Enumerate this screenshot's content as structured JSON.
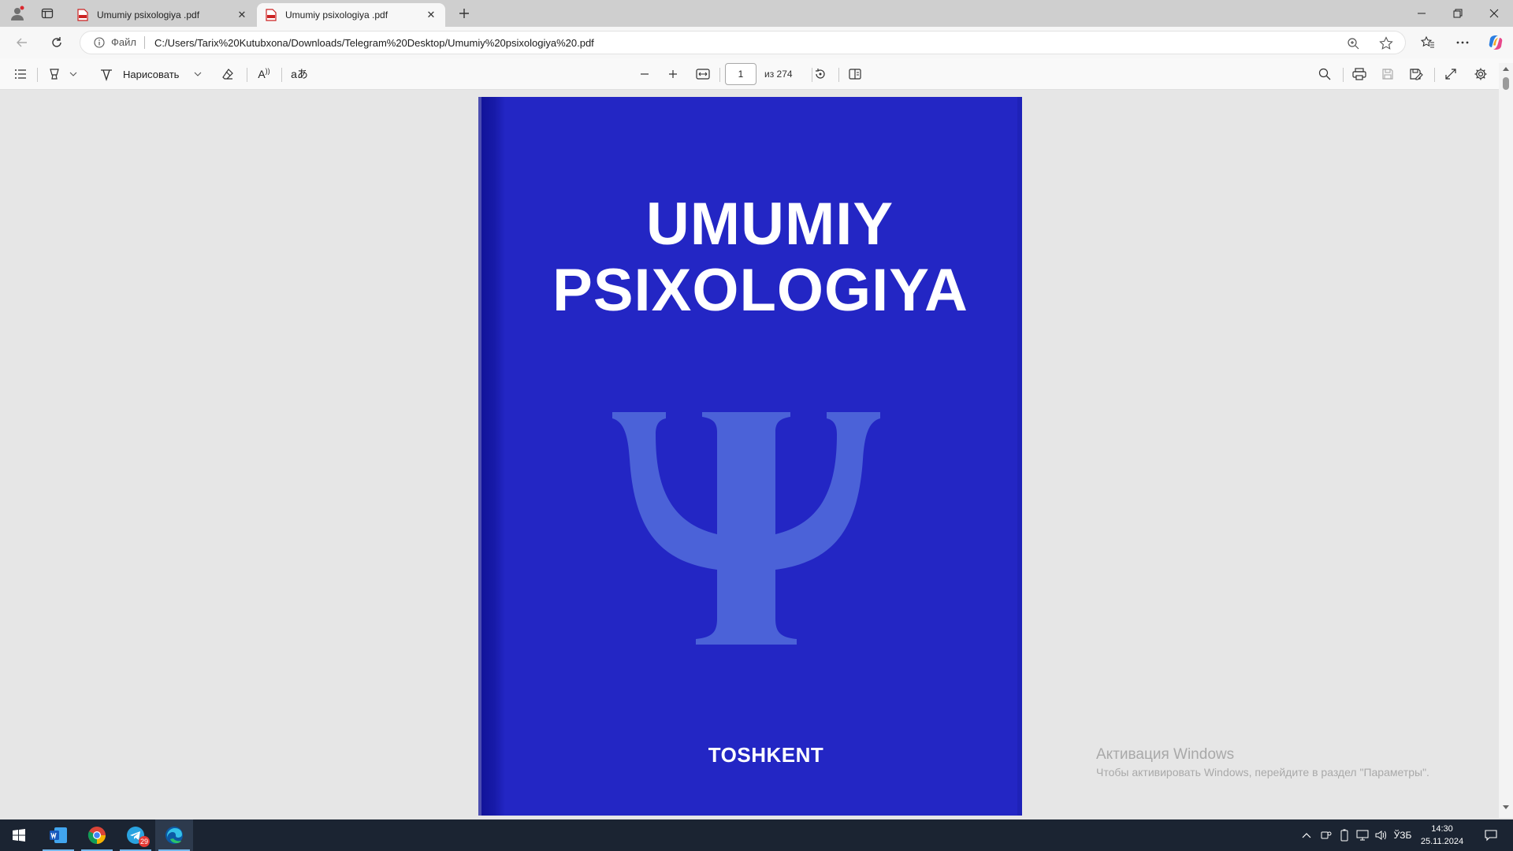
{
  "window": {
    "tabs": [
      {
        "title": "Umumiy psixologiya .pdf",
        "active": false
      },
      {
        "title": "Umumiy psixologiya .pdf",
        "active": true
      }
    ],
    "new_tab_icon": "plus-icon"
  },
  "address_bar": {
    "scheme_label": "Файл",
    "url": "C:/Users/Tarix%20Kutubxona/Downloads/Telegram%20Desktop/Umumiy%20psixologiya%20.pdf"
  },
  "pdf_toolbar": {
    "draw_label": "Нарисовать",
    "read_aloud_glyph": "A",
    "translate_glyph": "aあ",
    "page_current": "1",
    "page_total_label": "из 274"
  },
  "document": {
    "title_line1": "UMUMIY",
    "title_line2": "PSIXOLOGIYA",
    "footer": "TOSHKENT",
    "symbol": "psi-symbol",
    "cover_color": "#2326c4"
  },
  "activation": {
    "title": "Активация Windows",
    "text": "Чтобы активировать Windows, перейдите в раздел \"Параметры\"."
  },
  "taskbar": {
    "telegram_badge": "29",
    "language": "ЎЗБ",
    "time": "14:30",
    "date": "25.11.2024"
  },
  "colors": {
    "accent_edge": "#0c59a4",
    "taskbar_bg": "#1b2432",
    "taskbar_indicator": "#76b9ed"
  }
}
